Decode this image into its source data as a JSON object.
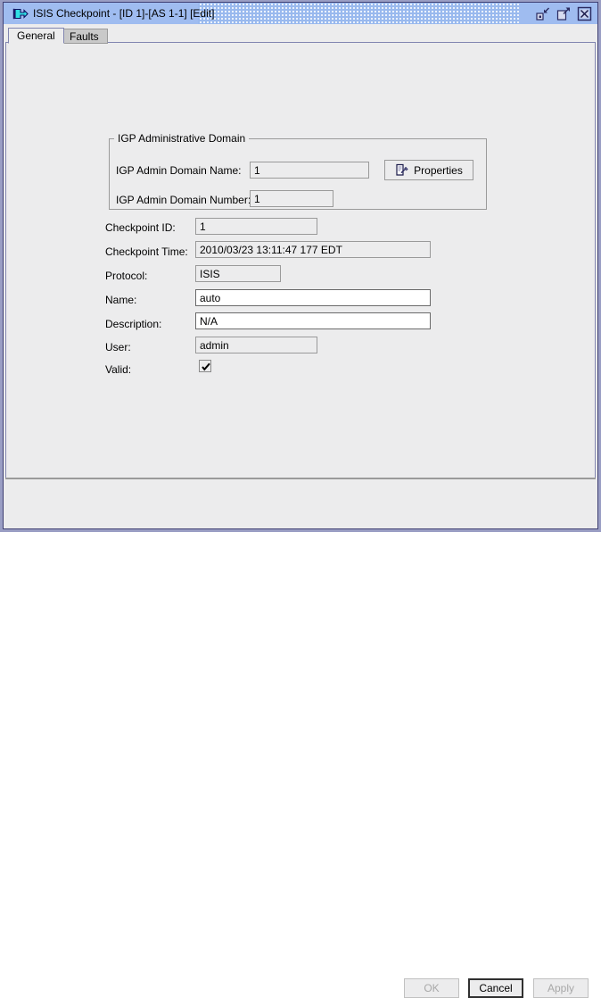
{
  "window": {
    "title": "ISIS Checkpoint - [ID 1]-[AS 1-1] [Edit]",
    "app_icon": "arrow-right-flag-icon",
    "controls": [
      {
        "name": "restore-button",
        "icon": "restore-icon"
      },
      {
        "name": "maximize-button",
        "icon": "maximize-icon"
      },
      {
        "name": "close-button",
        "icon": "close-icon"
      }
    ],
    "colors": {
      "titlebar": "#99b9ee",
      "frame": "#9a9ec4",
      "frame_dark": "#3f3f72",
      "panel": "#ececed",
      "field_readonly": "#ececed",
      "field_editable": "#ffffff",
      "border": "#9a9a9a",
      "disabled_text": "#a8a8a8",
      "icon_accent": "#00d8dc"
    }
  },
  "tabs": [
    {
      "label": "General",
      "selected": true
    },
    {
      "label": "Faults",
      "selected": false
    }
  ],
  "groupbox": {
    "title": "IGP Administrative Domain",
    "rows": [
      {
        "label": "IGP Admin Domain Name:",
        "value": "1",
        "editable": false
      },
      {
        "label": "IGP Admin Domain Number:",
        "value": "1",
        "editable": false
      }
    ],
    "properties_button": {
      "label": "Properties",
      "icon": "document-pen-icon"
    }
  },
  "form": {
    "rows": [
      {
        "label": "Checkpoint ID:",
        "value": "1",
        "editable": false
      },
      {
        "label": "Checkpoint Time:",
        "value": "2010/03/23 13:11:47 177 EDT",
        "editable": false
      },
      {
        "label": "Protocol:",
        "value": "ISIS",
        "editable": false
      },
      {
        "label": "Name:",
        "value": "auto",
        "editable": true
      },
      {
        "label": "Description:",
        "value": "N/A",
        "editable": true
      },
      {
        "label": "User:",
        "value": "admin",
        "editable": false
      }
    ],
    "valid": {
      "label": "Valid:",
      "checked": true
    }
  },
  "footer": {
    "buttons": [
      {
        "label": "OK",
        "enabled": false,
        "default": false
      },
      {
        "label": "Cancel",
        "enabled": true,
        "default": true
      },
      {
        "label": "Apply",
        "enabled": false,
        "default": false
      }
    ]
  }
}
